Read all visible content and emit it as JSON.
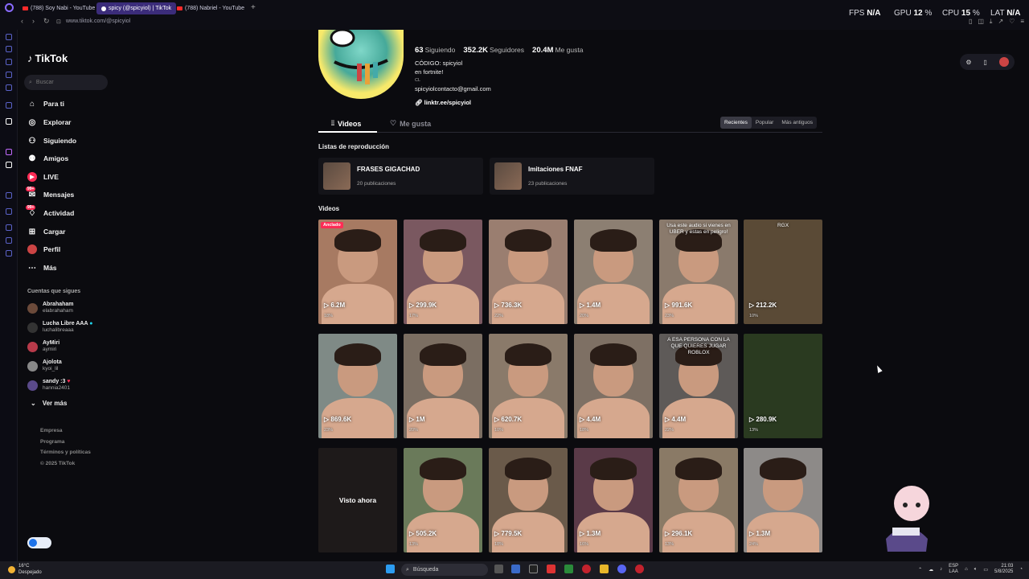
{
  "browser": {
    "tabs": [
      {
        "label": "(788) Soy Nabi - YouTube",
        "type": "youtube"
      },
      {
        "label": "spicy (@spicyiol) | TikTok",
        "type": "tiktok",
        "active": true
      },
      {
        "label": "(788) Nabriel - YouTube",
        "type": "youtube"
      }
    ],
    "new_tab": "+",
    "url": "www.tiktok.com/@spicyiol"
  },
  "hud": {
    "fps_label": "FPS",
    "fps_value": "N/A",
    "gpu_label": "GPU",
    "gpu_value": "12",
    "cpu_label": "CPU",
    "cpu_value": "15",
    "lat_label": "LAT",
    "lat_value": "N/A",
    "percent": "%"
  },
  "sidebar": {
    "logo": "TikTok",
    "search_placeholder": "Buscar",
    "menu": [
      {
        "label": "Para ti",
        "icon": "home-icon"
      },
      {
        "label": "Explorar",
        "icon": "compass-icon"
      },
      {
        "label": "Siguiendo",
        "icon": "following-icon"
      },
      {
        "label": "Amigos",
        "icon": "friends-icon"
      },
      {
        "label": "LIVE",
        "icon": "live-icon"
      },
      {
        "label": "Mensajes",
        "icon": "messages-icon",
        "badge": "99+"
      },
      {
        "label": "Actividad",
        "icon": "activity-icon",
        "badge": "99+"
      },
      {
        "label": "Cargar",
        "icon": "upload-icon"
      },
      {
        "label": "Perfil",
        "icon": "profile-icon"
      },
      {
        "label": "Más",
        "icon": "more-icon"
      }
    ],
    "following_title": "Cuentas que sigues",
    "following": [
      {
        "name": "Abrahaham",
        "user": "elabrahaham"
      },
      {
        "name": "Lucha Libre AAA",
        "user": "luchalibreaaa",
        "verified": true
      },
      {
        "name": "AyMiri",
        "user": "aymiri"
      },
      {
        "name": "Ajolota",
        "user": "kyoi_lil"
      },
      {
        "name": "sandy :3",
        "user": "hannia2401",
        "heart": true
      }
    ],
    "see_more": "Ver más",
    "footer": [
      "Empresa",
      "Programa",
      "Términos y políticas",
      "© 2025 TikTok"
    ]
  },
  "profile": {
    "following_count": "63",
    "following_label": "Siguiendo",
    "followers_count": "352.2K",
    "followers_label": "Seguidores",
    "likes_count": "20.4M",
    "likes_label": "Me gusta",
    "bio": [
      "CÓDIGO: spicyiol",
      "en fortnite!",
      "CL",
      "spicyiolcontacto@gmail.com"
    ],
    "link": "linktr.ee/spicyiol",
    "tabs": [
      "Videos",
      "Me gusta"
    ],
    "sort": [
      "Recientes",
      "Popular",
      "Más antiguos"
    ],
    "playlists_title": "Listas de reproducción",
    "playlists": [
      {
        "title": "FRASES GIGACHAD",
        "count": "20 publicaciones"
      },
      {
        "title": "Imitaciones FNAF",
        "count": "23 publicaciones"
      }
    ],
    "videos_title": "Videos",
    "videos": [
      {
        "views": "6.2M",
        "pct": "18%",
        "pinned": "Anclado",
        "bg": "#a77a62"
      },
      {
        "views": "299.9K",
        "pct": "17%",
        "bg": "#7a5860"
      },
      {
        "views": "736.3K",
        "pct": "22%",
        "bg": "#9a7e70"
      },
      {
        "views": "1.4M",
        "pct": "20%",
        "bg": "#8c7f72"
      },
      {
        "views": "991.6K",
        "pct": "23%",
        "caption": "Usa este audio si vienes en UBER y estas en peligro!",
        "bg": "#8a7a6c"
      },
      {
        "views": "212.2K",
        "pct": "10%",
        "caption": "RGX",
        "bg": "#5a4a36"
      },
      {
        "views": "869.6K",
        "pct": "23%",
        "bg": "#7f8a86"
      },
      {
        "views": "1M",
        "pct": "20%",
        "bg": "#7b6e62"
      },
      {
        "views": "620.7K",
        "pct": "10%",
        "bg": "#8a7a6a"
      },
      {
        "views": "4.4M",
        "pct": "18%",
        "bg": "#7e7064"
      },
      {
        "views": "4.4M",
        "pct": "22%",
        "caption": "A ESA PERSONA CON LA QUE QUIERES JUGAR ROBLOX",
        "bg": "#5e5a58"
      },
      {
        "views": "280.9K",
        "pct": "13%",
        "bg": "#2a3a20"
      },
      {
        "views": "",
        "pct": "",
        "center": "Visto ahora",
        "bg": "#1e1a1a"
      },
      {
        "views": "505.2K",
        "pct": "13%",
        "bg": "#6a7a5a"
      },
      {
        "views": "779.5K",
        "pct": "18%",
        "bg": "#6a5a4a"
      },
      {
        "views": "1.3M",
        "pct": "16%",
        "bg": "#5a3a48"
      },
      {
        "views": "296.1K",
        "pct": "13%",
        "bg": "#8a7a66"
      },
      {
        "views": "1.3M",
        "pct": "24%",
        "bg": "#8d8a88"
      }
    ]
  },
  "taskbar": {
    "temp": "16°C",
    "weather": "Despejado",
    "search": "Búsqueda",
    "lang": "ESP",
    "lang2": "LAA",
    "time": "21:03",
    "date": "5/8/2025"
  }
}
